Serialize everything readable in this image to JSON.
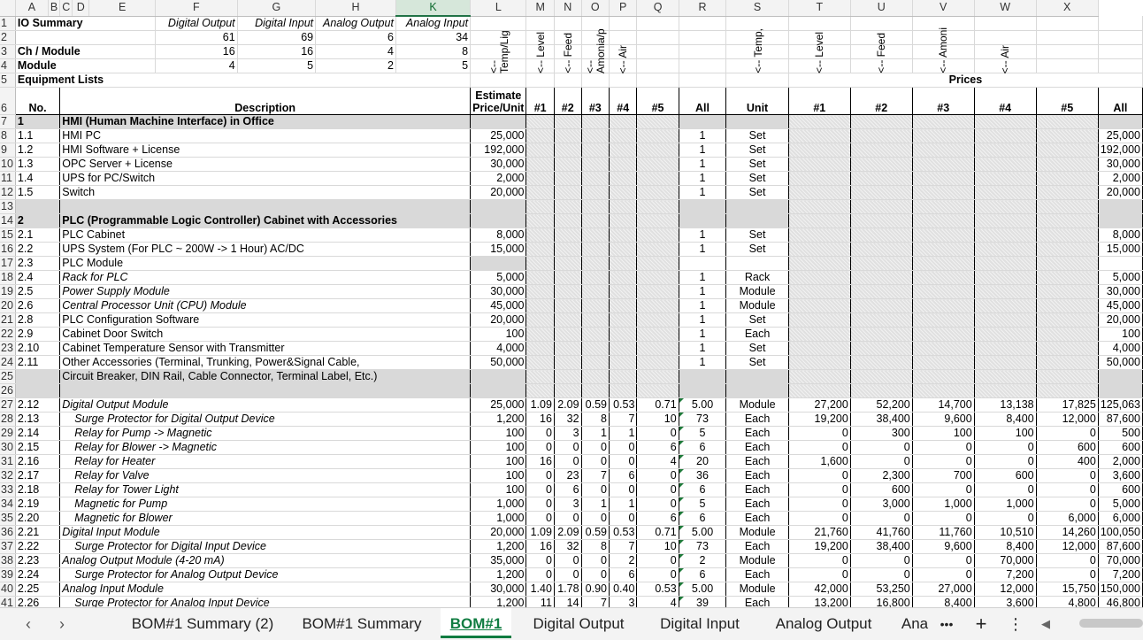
{
  "columns": [
    "A",
    "B",
    "C",
    "D",
    "E",
    "F",
    "G",
    "H",
    "K",
    "L",
    "M",
    "N",
    "O",
    "P",
    "Q",
    "R",
    "S",
    "T",
    "U",
    "V",
    "W",
    "X"
  ],
  "io_summary": {
    "title": "IO Summary",
    "headers": [
      "Digital Output",
      "Digital Input",
      "Analog Output",
      "Analog Input"
    ],
    "row2": [
      "61",
      "69",
      "6",
      "34"
    ],
    "ch_label": "Ch / Module",
    "row3": [
      "16",
      "16",
      "4",
      "8"
    ],
    "module_label": "Module",
    "row4": [
      "4",
      "5",
      "2",
      "5"
    ]
  },
  "equipment_lists": "Equipment Lists",
  "prices_label": "Prices",
  "rotated": {
    "L": "<-- Temp/Lig",
    "M": "<-- Level",
    "N": "<-- Feed",
    "O": "<-- Amonia/p",
    "P": "<-- Air",
    "S": "<-- Temp,",
    "T": "<-- Level",
    "U": "<-- Feed",
    "V": "<-- Amoni",
    "W": "<-- Air"
  },
  "header": {
    "no": "No.",
    "description": "Description",
    "estimate_line1": "Estimate",
    "estimate_line2": "Price/Unit",
    "h1": "#1",
    "h2": "#2",
    "h3": "#3",
    "h4": "#4",
    "h5": "#5",
    "all": "All",
    "unit": "Unit",
    "p1": "#1",
    "p2": "#2",
    "p3": "#3",
    "p4": "#4",
    "p5": "#5",
    "pall": "All"
  },
  "rows": [
    {
      "r": "7",
      "no": "1",
      "desc": "HMI (Human Machine Interface) in Office",
      "style": "section"
    },
    {
      "r": "8",
      "no": "1.1",
      "desc": "HMI PC",
      "price": "25,000",
      "all": "1",
      "unit": "Set",
      "pall": "25,000",
      "style": "plain"
    },
    {
      "r": "9",
      "no": "1.2",
      "desc": "HMI Software + License",
      "price": "192,000",
      "all": "1",
      "unit": "Set",
      "pall": "192,000",
      "style": "plain"
    },
    {
      "r": "10",
      "no": "1.3",
      "desc": "OPC Server + License",
      "price": "30,000",
      "all": "1",
      "unit": "Set",
      "pall": "30,000",
      "style": "plain"
    },
    {
      "r": "11",
      "no": "1.4",
      "desc": "UPS for PC/Switch",
      "price": "2,000",
      "all": "1",
      "unit": "Set",
      "pall": "2,000",
      "style": "plain"
    },
    {
      "r": "12",
      "no": "1.5",
      "desc": "Switch",
      "price": "20,000",
      "all": "1",
      "unit": "Set",
      "pall": "20,000",
      "style": "plain"
    },
    {
      "r": "13",
      "no": "",
      "desc": "",
      "style": "blank"
    },
    {
      "r": "14",
      "no": "2",
      "desc": "PLC (Programmable Logic Controller) Cabinet with Accessories",
      "style": "section"
    },
    {
      "r": "15",
      "no": "2.1",
      "desc": "PLC Cabinet",
      "price": "8,000",
      "all": "1",
      "unit": "Set",
      "pall": "8,000",
      "style": "plain"
    },
    {
      "r": "16",
      "no": "2.2",
      "desc": "UPS System (For PLC ~ 200W -> 1 Hour) AC/DC",
      "price": "15,000",
      "all": "1",
      "unit": "Set",
      "pall": "15,000",
      "style": "plain"
    },
    {
      "r": "17",
      "no": "2.3",
      "desc": "PLC Module",
      "style": "sub"
    },
    {
      "r": "18",
      "no": "2.4",
      "desc": "Rack for PLC",
      "price": "5,000",
      "all": "1",
      "unit": "Rack",
      "pall": "5,000",
      "style": "italic"
    },
    {
      "r": "19",
      "no": "2.5",
      "desc": "Power Supply Module",
      "price": "30,000",
      "all": "1",
      "unit": "Module",
      "pall": "30,000",
      "style": "italic"
    },
    {
      "r": "20",
      "no": "2.6",
      "desc": "Central Processor Unit (CPU) Module",
      "price": "45,000",
      "all": "1",
      "unit": "Module",
      "pall": "45,000",
      "style": "italic"
    },
    {
      "r": "21",
      "no": "2.8",
      "desc": "PLC Configuration Software",
      "price": "20,000",
      "all": "1",
      "unit": "Set",
      "pall": "20,000",
      "style": "plain"
    },
    {
      "r": "22",
      "no": "2.9",
      "desc": "Cabinet Door Switch",
      "price": "100",
      "all": "1",
      "unit": "Each",
      "pall": "100",
      "style": "plain"
    },
    {
      "r": "23",
      "no": "2.10",
      "desc": "Cabinet Temperature Sensor with Transmitter",
      "price": "4,000",
      "all": "1",
      "unit": "Set",
      "pall": "4,000",
      "style": "plain"
    },
    {
      "r": "24",
      "no": "2.11",
      "desc": "Other Accessories (Terminal, Trunking, Power&Signal Cable,",
      "price": "50,000",
      "all": "1",
      "unit": "Set",
      "pall": "50,000",
      "style": "plain"
    },
    {
      "r": "25",
      "no": "",
      "desc": "Circuit Breaker, DIN Rail, Cable Connector, Terminal Label, Etc.)",
      "style": "cont"
    },
    {
      "r": "26",
      "no": "",
      "desc": "",
      "style": "blank"
    },
    {
      "r": "27",
      "no": "2.12",
      "desc": "Digital Output Module",
      "price": "25,000",
      "q": [
        "1.09",
        "2.09",
        "0.59",
        "0.53",
        "0.71"
      ],
      "all": "5.00",
      "unit": "Module",
      "p": [
        "27,200",
        "52,200",
        "14,700",
        "13,138",
        "17,825"
      ],
      "pall": "125,063",
      "style": "italic"
    },
    {
      "r": "28",
      "no": "2.13",
      "desc": "Surge Protector for Digital Output Device",
      "price": "1,200",
      "q": [
        "16",
        "32",
        "8",
        "7",
        "10"
      ],
      "all": "73",
      "unit": "Each",
      "p": [
        "19,200",
        "38,400",
        "9,600",
        "8,400",
        "12,000"
      ],
      "pall": "87,600",
      "style": "italic-ind"
    },
    {
      "r": "29",
      "no": "2.14",
      "desc": "Relay for Pump -> Magnetic",
      "price": "100",
      "q": [
        "0",
        "3",
        "1",
        "1",
        "0"
      ],
      "all": "5",
      "unit": "Each",
      "p": [
        "0",
        "300",
        "100",
        "100",
        "0"
      ],
      "pall": "500",
      "style": "italic-ind"
    },
    {
      "r": "30",
      "no": "2.15",
      "desc": "Relay for Blower -> Magnetic",
      "price": "100",
      "q": [
        "0",
        "0",
        "0",
        "0",
        "6"
      ],
      "all": "6",
      "unit": "Each",
      "p": [
        "0",
        "0",
        "0",
        "0",
        "600"
      ],
      "pall": "600",
      "style": "italic-ind"
    },
    {
      "r": "31",
      "no": "2.16",
      "desc": "Relay for Heater",
      "price": "100",
      "q": [
        "16",
        "0",
        "0",
        "0",
        "4"
      ],
      "all": "20",
      "unit": "Each",
      "p": [
        "1,600",
        "0",
        "0",
        "0",
        "400"
      ],
      "pall": "2,000",
      "style": "italic-ind"
    },
    {
      "r": "32",
      "no": "2.17",
      "desc": "Relay for Valve",
      "price": "100",
      "q": [
        "0",
        "23",
        "7",
        "6",
        "0"
      ],
      "all": "36",
      "unit": "Each",
      "p": [
        "0",
        "2,300",
        "700",
        "600",
        "0"
      ],
      "pall": "3,600",
      "style": "italic-ind"
    },
    {
      "r": "33",
      "no": "2.18",
      "desc": "Relay for Tower Light",
      "price": "100",
      "q": [
        "0",
        "6",
        "0",
        "0",
        "0"
      ],
      "all": "6",
      "unit": "Each",
      "p": [
        "0",
        "600",
        "0",
        "0",
        "0"
      ],
      "pall": "600",
      "style": "italic-ind"
    },
    {
      "r": "34",
      "no": "2.19",
      "desc": "Magnetic for Pump",
      "price": "1,000",
      "q": [
        "0",
        "3",
        "1",
        "1",
        "0"
      ],
      "all": "5",
      "unit": "Each",
      "p": [
        "0",
        "3,000",
        "1,000",
        "1,000",
        "0"
      ],
      "pall": "5,000",
      "style": "italic-ind"
    },
    {
      "r": "35",
      "no": "2.20",
      "desc": "Magnetic for Blower",
      "price": "1,000",
      "q": [
        "0",
        "0",
        "0",
        "0",
        "6"
      ],
      "all": "6",
      "unit": "Each",
      "p": [
        "0",
        "0",
        "0",
        "0",
        "6,000"
      ],
      "pall": "6,000",
      "style": "italic-ind"
    },
    {
      "r": "36",
      "no": "2.21",
      "desc": "Digital Input Module",
      "price": "20,000",
      "q": [
        "1.09",
        "2.09",
        "0.59",
        "0.53",
        "0.71"
      ],
      "all": "5.00",
      "unit": "Module",
      "p": [
        "21,760",
        "41,760",
        "11,760",
        "10,510",
        "14,260"
      ],
      "pall": "100,050",
      "style": "italic"
    },
    {
      "r": "37",
      "no": "2.22",
      "desc": "Surge Protector for Digital Input Device",
      "price": "1,200",
      "q": [
        "16",
        "32",
        "8",
        "7",
        "10"
      ],
      "all": "73",
      "unit": "Each",
      "p": [
        "19,200",
        "38,400",
        "9,600",
        "8,400",
        "12,000"
      ],
      "pall": "87,600",
      "style": "italic-ind"
    },
    {
      "r": "38",
      "no": "2.23",
      "desc": "Analog Output Module (4-20 mA)",
      "price": "35,000",
      "q": [
        "0",
        "0",
        "0",
        "2",
        "0"
      ],
      "all": "2",
      "unit": "Module",
      "p": [
        "0",
        "0",
        "0",
        "70,000",
        "0"
      ],
      "pall": "70,000",
      "style": "italic"
    },
    {
      "r": "39",
      "no": "2.24",
      "desc": "Surge Protector for Analog Output Device",
      "price": "1,200",
      "q": [
        "0",
        "0",
        "0",
        "6",
        "0"
      ],
      "all": "6",
      "unit": "Each",
      "p": [
        "0",
        "0",
        "0",
        "7,200",
        "0"
      ],
      "pall": "7,200",
      "style": "italic-ind"
    },
    {
      "r": "40",
      "no": "2.25",
      "desc": "Analog Input Module",
      "price": "30,000",
      "q": [
        "1.40",
        "1.78",
        "0.90",
        "0.40",
        "0.53"
      ],
      "all": "5.00",
      "unit": "Module",
      "p": [
        "42,000",
        "53,250",
        "27,000",
        "12,000",
        "15,750"
      ],
      "pall": "150,000",
      "style": "italic"
    },
    {
      "r": "41",
      "no": "2.26",
      "desc": "Surge Protector for Analog Input Device",
      "price": "1,200",
      "q": [
        "11",
        "14",
        "7",
        "3",
        "4"
      ],
      "all": "39",
      "unit": "Each",
      "p": [
        "13,200",
        "16,800",
        "8,400",
        "3,600",
        "4,800"
      ],
      "pall": "46,800",
      "style": "italic-ind"
    }
  ],
  "tabs": {
    "t1": "BOM#1 Summary (2)",
    "t2": "BOM#1 Summary",
    "t3": "BOM#1",
    "t4": "Digital Output",
    "t5": "Digital Input",
    "t6": "Analog Output",
    "t7": "Ana",
    "more": "•••",
    "add": "+",
    "menu": "⋮",
    "scroll_left": "◀"
  }
}
